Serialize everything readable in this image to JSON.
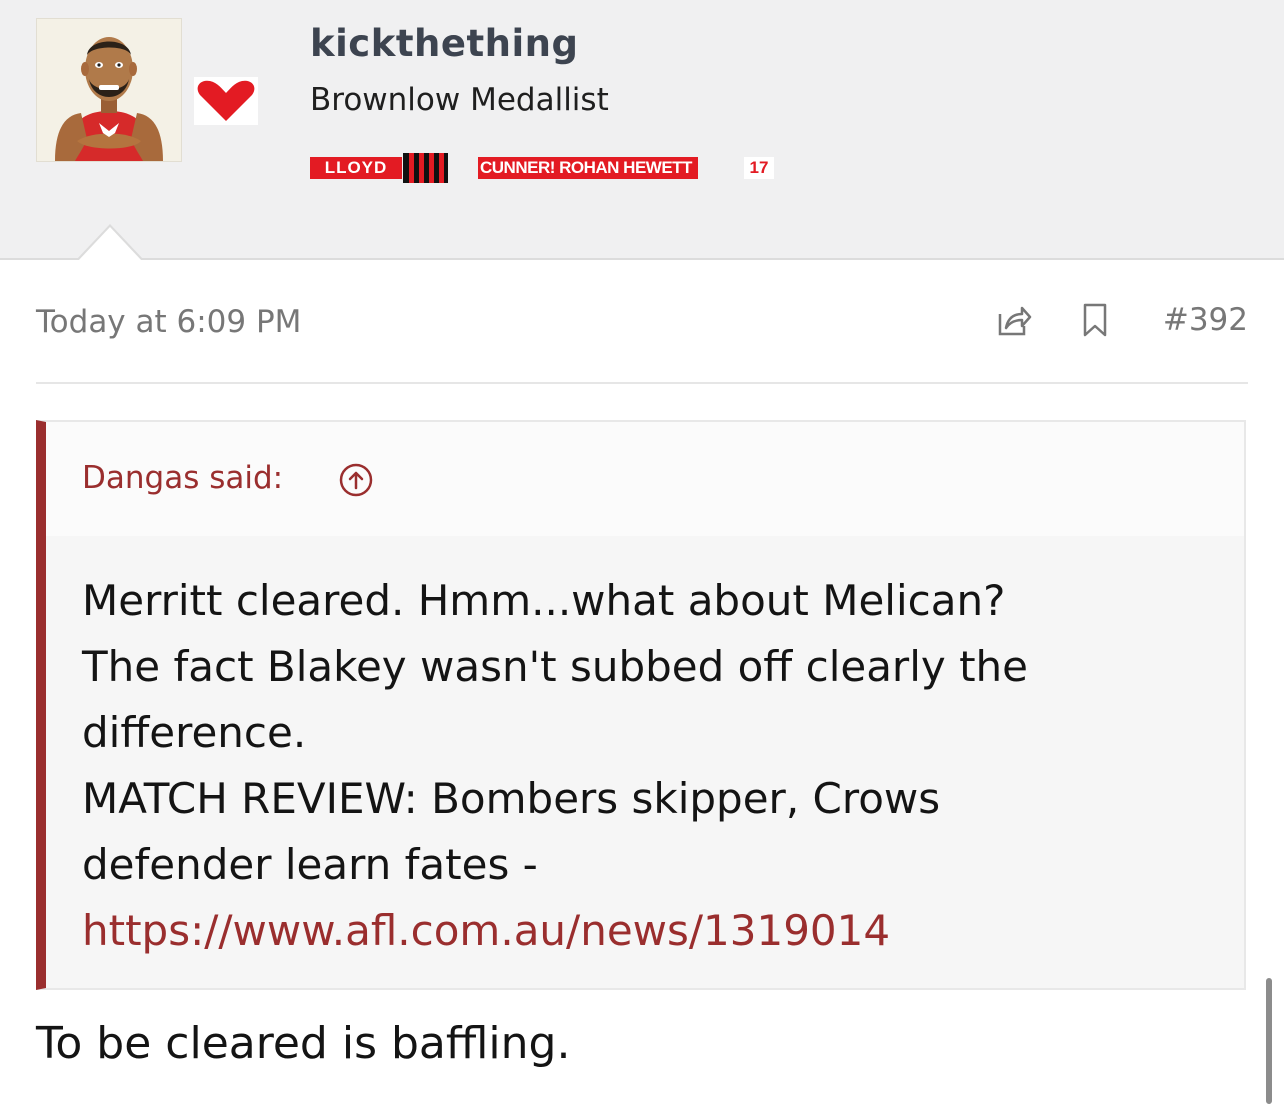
{
  "user": {
    "username": "kickthething",
    "title": "Brownlow Medallist",
    "avatar_icon": "caricature-avatar-icon",
    "team_icon": "heart-icon",
    "team_color": "#e31b23",
    "badges": {
      "lloyd": "LLOYD",
      "cunner": "CUNNER! ROHAN HEWETT",
      "number": "17"
    }
  },
  "post": {
    "timestamp": "Today at 6:09 PM",
    "number": "#392",
    "share_icon": "share-icon",
    "bookmark_icon": "bookmark-icon",
    "quote": {
      "author": "Dangas said:",
      "jump_icon": "arrow-up-circle-icon",
      "lines": [
        "Merritt cleared. Hmm...what about Melican?",
        "The fact Blakey wasn't subbed off clearly the",
        "difference.",
        "MATCH REVIEW: Bombers skipper, Crows",
        "defender learn fates -"
      ],
      "link": "https://www.afl.com.au/news/1319014",
      "accent_color": "#9a2e2e"
    },
    "reply": "To be cleared is baffling."
  }
}
